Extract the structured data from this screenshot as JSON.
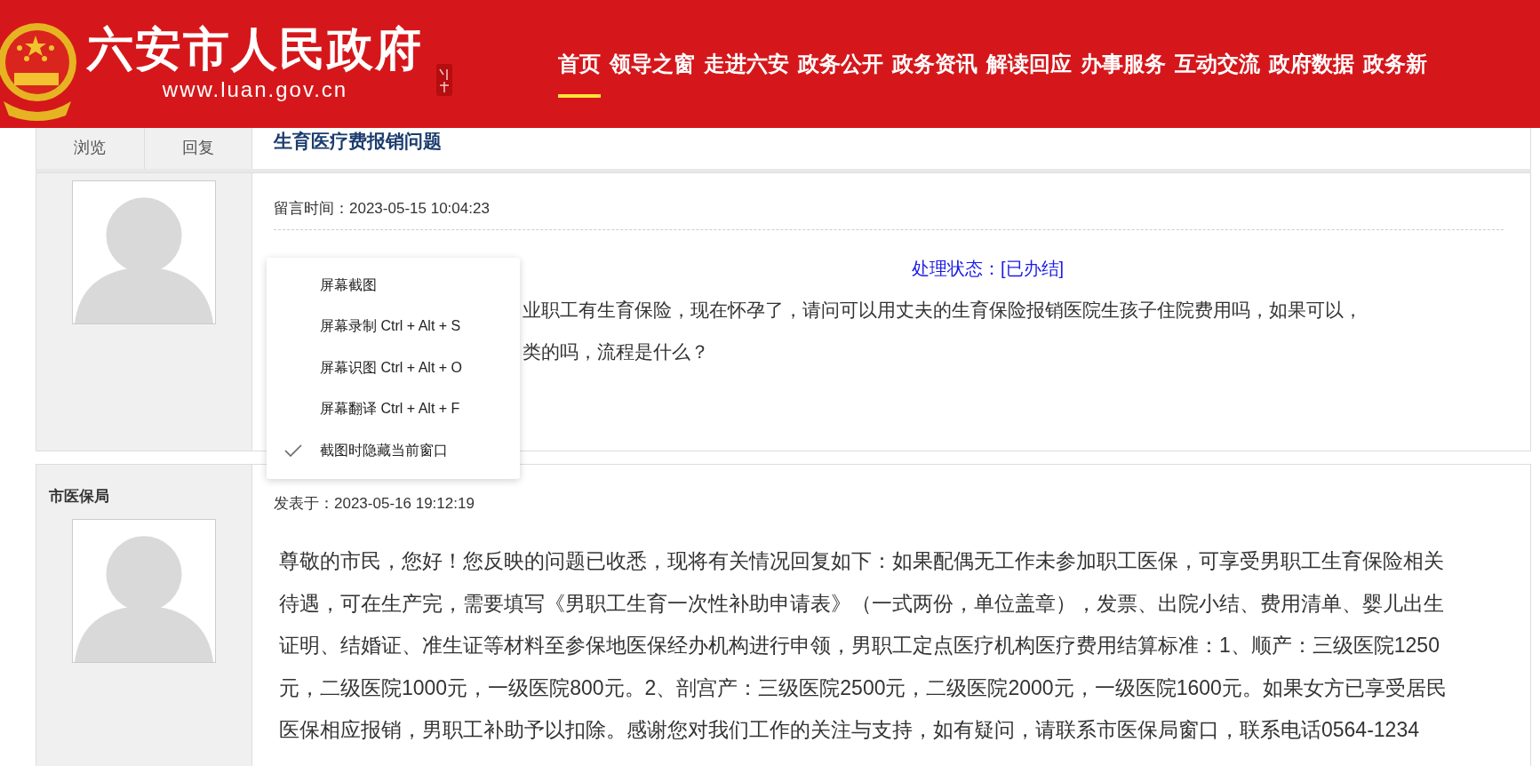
{
  "header": {
    "title": "六安市人民政府",
    "url": "www.luan.gov.cn",
    "nav": [
      {
        "label": "首页",
        "selected": true
      },
      {
        "label": "领导之窗",
        "selected": false
      },
      {
        "label": "走进六安",
        "selected": false
      },
      {
        "label": "政务公开",
        "selected": false
      },
      {
        "label": "政务资讯",
        "selected": false
      },
      {
        "label": "解读回应",
        "selected": false
      },
      {
        "label": "办事服务",
        "selected": false
      },
      {
        "label": "互动交流",
        "selected": false
      },
      {
        "label": "政府数据",
        "selected": false
      },
      {
        "label": "政务新",
        "selected": false
      }
    ]
  },
  "topic": {
    "stats": [
      "浏览",
      "回复"
    ],
    "title": "生育医疗费报销问题"
  },
  "message": {
    "time": "留言时间：2023-05-15 10:04:23",
    "status": "处理状态：[已办结]",
    "text_lines": [
      "业职工有生育保险，现在怀孕了，请问可以用丈夫的生育保险报销医院生孩子住院费用吗，如果可以，",
      "类的吗，流程是什么？"
    ]
  },
  "context_menu": {
    "items": [
      {
        "label": "屏幕截图",
        "checked": false
      },
      {
        "label": "屏幕录制 Ctrl + Alt + S",
        "checked": false
      },
      {
        "label": "屏幕识图 Ctrl + Alt + O",
        "checked": false
      },
      {
        "label": "屏幕翻译 Ctrl + Alt + F",
        "checked": false
      },
      {
        "label": "截图时隐藏当前窗口",
        "checked": true
      }
    ]
  },
  "reply": {
    "author": "市医保局",
    "time": "发表于：2023-05-16 19:12:19",
    "text": "尊敬的市民，您好！您反映的问题已收悉，现将有关情况回复如下：如果配偶无工作未参加职工医保，可享受男职工生育保险相关待遇，可在生产完，需要填写《男职工生育一次性补助申请表》（一式两份，单位盖章），发票、出院小结、费用清单、婴儿出生证明、结婚证、准生证等材料至参保地医保经办机构进行申领，男职工定点医疗机构医疗费用结算标准：1、顺产：三级医院1250元，二级医院1000元，一级医院800元。2、剖宫产：三级医院2500元，二级医院2000元，一级医院1600元。如果女方已享受居民医保相应报销，男职工补助予以扣除。感谢您对我们工作的关注与支持，如有疑问，请联系市医保局窗口，联系电话0564-1234"
  }
}
